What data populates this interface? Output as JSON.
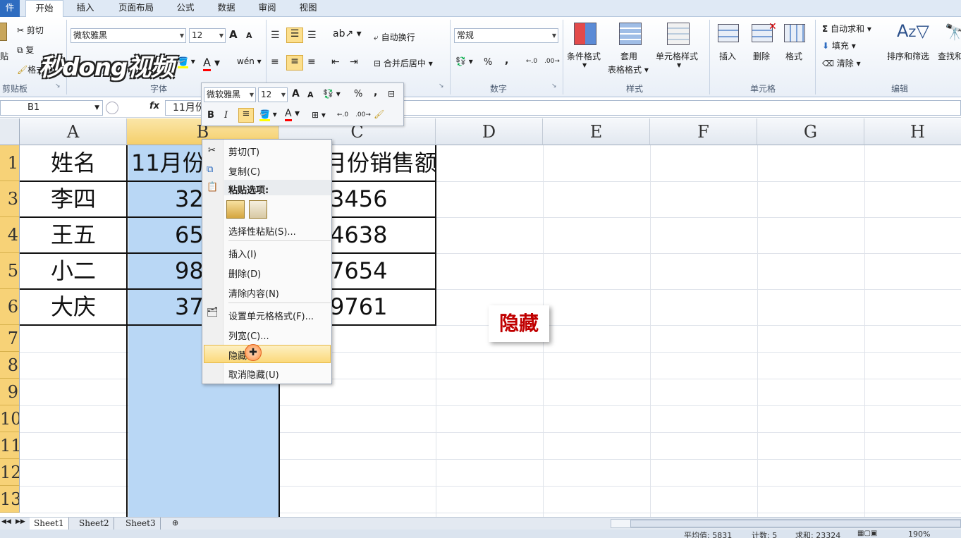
{
  "tabs": {
    "file": "件",
    "items": [
      "开始",
      "插入",
      "页面布局",
      "公式",
      "数据",
      "审阅",
      "视图"
    ]
  },
  "ribbon": {
    "clipboard": {
      "paste": "贴",
      "cut": "剪切",
      "copy": "复",
      "format_painter": "格式刷",
      "label": "剪贴板"
    },
    "font": {
      "name": "微软雅黑",
      "size": "12",
      "label": "字体",
      "grow": "A",
      "shrink": "A"
    },
    "alignment": {
      "wrap": "自动换行",
      "merge": "合并后居中",
      "label": ""
    },
    "number": {
      "format": "常规",
      "percent": "%",
      "comma": ",",
      "label": "数字"
    },
    "styles": {
      "conditional": "条件格式",
      "table_line1": "套用",
      "table_line2": "表格格式",
      "cell_styles": "单元格样式",
      "label": "样式"
    },
    "cells": {
      "insert": "插入",
      "delete": "删除",
      "format": "格式",
      "label": "单元格"
    },
    "editing": {
      "autosum": "自动求和",
      "fill": "填充",
      "clear": "清除",
      "sort_filter": "排序和筛选",
      "find": "查找和",
      "label": "编辑"
    },
    "watermark": "秒dong视频"
  },
  "formula_bar": {
    "name_box": "B1",
    "fx": "fx",
    "value": "11月份"
  },
  "grid": {
    "columns": [
      "A",
      "B",
      "C",
      "D",
      "E",
      "F",
      "G",
      "H"
    ],
    "rows": [
      "1",
      "3",
      "4",
      "5",
      "6",
      "7",
      "8",
      "9",
      "10",
      "11",
      "12",
      "13"
    ],
    "A": [
      "姓名",
      "李四",
      "王五",
      "小二",
      "大庆"
    ],
    "B": [
      "11月份",
      "32",
      "65",
      "98",
      "37"
    ],
    "C": [
      "月份销售额",
      "3456",
      "4638",
      "7654",
      "9761"
    ]
  },
  "mini_toolbar": {
    "font": "微软雅黑",
    "size": "12",
    "bold": "B",
    "italic": "I",
    "percent": "%",
    "comma": ","
  },
  "context_menu": {
    "cut": "剪切(T)",
    "copy": "复制(C)",
    "paste_options": "粘贴选项:",
    "paste_special": "选择性粘贴(S)...",
    "insert": "插入(I)",
    "delete": "删除(D)",
    "clear": "清除内容(N)",
    "format_cells": "设置单元格格式(F)...",
    "col_width": "列宽(C)...",
    "hide": "隐藏",
    "unhide": "取消隐藏(U)"
  },
  "callout": "隐藏",
  "sheets": [
    "Sheet1",
    "Sheet2",
    "Sheet3"
  ],
  "status": {
    "average": "平均值: 5831",
    "count": "计数: 5",
    "sum": "求和: 23324",
    "zoom": "190%"
  },
  "colors": {
    "accent": "#2e6cc0",
    "selection": "#b9d7f5",
    "header_sel": "#f7d277",
    "callout_text": "#c00000"
  }
}
